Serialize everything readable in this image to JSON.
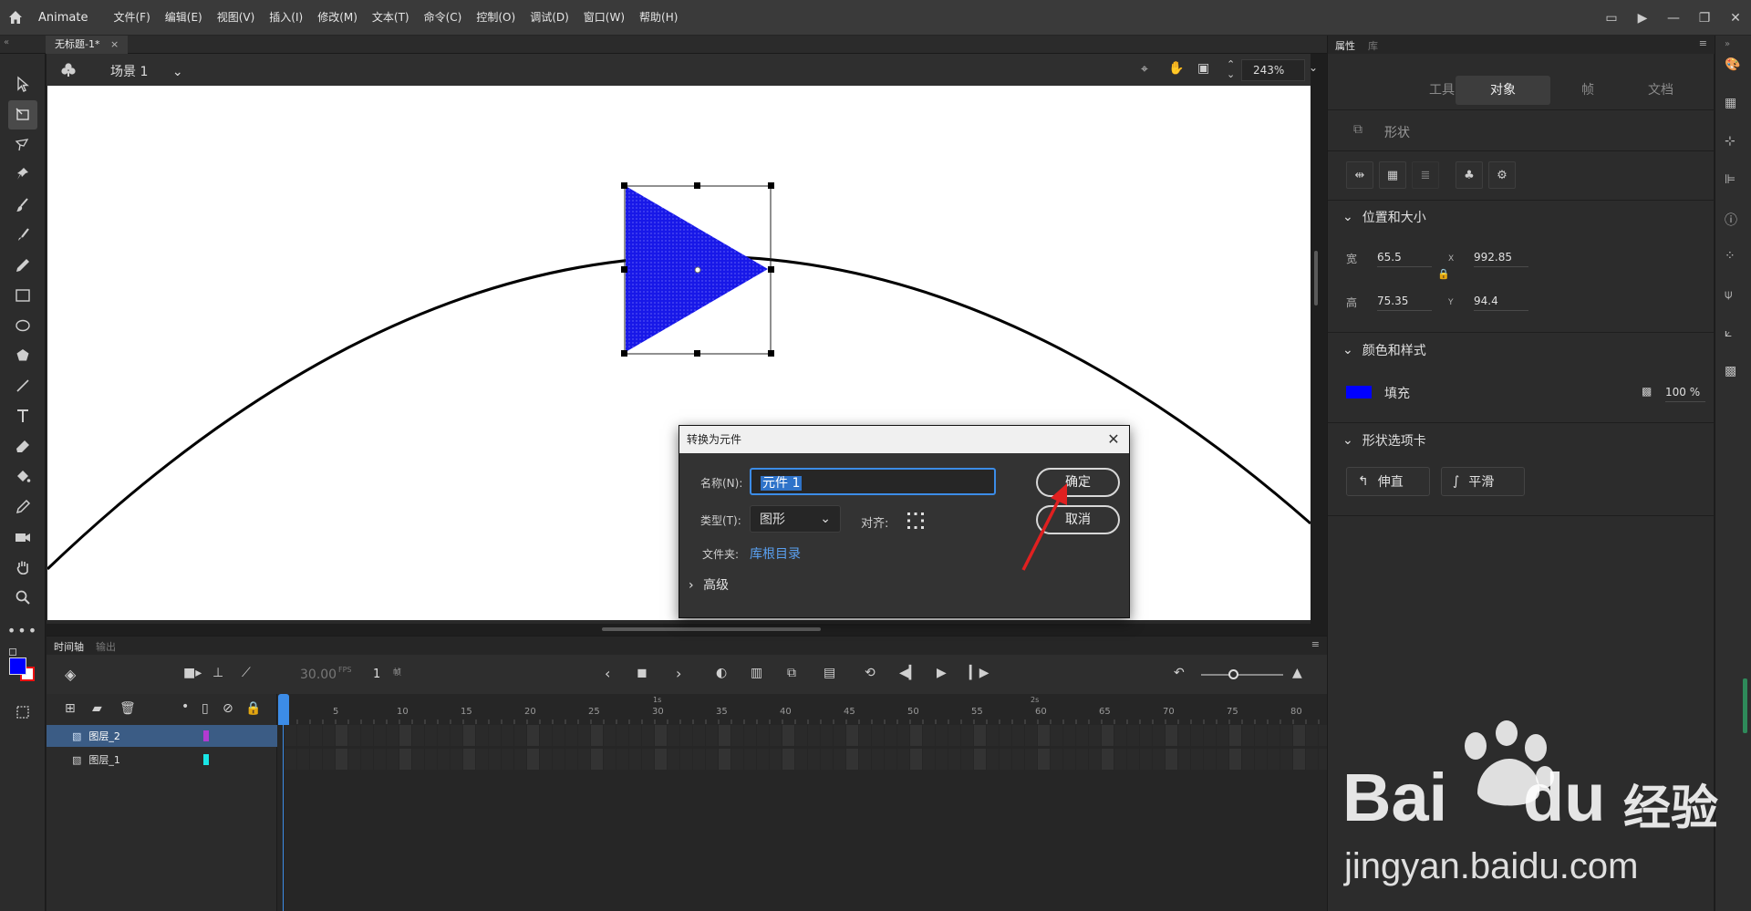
{
  "menubar": {
    "app_name": "Animate",
    "items": [
      "文件(F)",
      "编辑(E)",
      "视图(V)",
      "插入(I)",
      "修改(M)",
      "文本(T)",
      "命令(C)",
      "控制(O)",
      "调试(D)",
      "窗口(W)",
      "帮助(H)"
    ]
  },
  "document": {
    "tab_label": "无标题-1*",
    "scene_label": "场景 1",
    "zoom": "243%"
  },
  "dialog": {
    "title": "转换为元件",
    "name_label": "名称(N):",
    "name_value": "元件 1",
    "type_label": "类型(T):",
    "type_value": "图形",
    "align_label": "对齐:",
    "folder_label": "文件夹:",
    "folder_value": "库根目录",
    "advanced_label": "高级",
    "ok_label": "确定",
    "cancel_label": "取消"
  },
  "timeline": {
    "tab_timeline": "时间轴",
    "tab_output": "输出",
    "fps": "30.00",
    "fps_unit": "FPS",
    "current_frame": "1",
    "frame_unit": "帧",
    "time_markers": [
      "1s",
      "2s"
    ],
    "frame_numbers": [
      "5",
      "10",
      "15",
      "20",
      "25",
      "30",
      "35",
      "40",
      "45",
      "50",
      "55",
      "60",
      "65",
      "70",
      "75",
      "80"
    ],
    "layers": [
      {
        "name": "图层_2",
        "color": "#b23bd1",
        "selected": true
      },
      {
        "name": "图层_1",
        "color": "#19e6e6",
        "selected": false
      }
    ]
  },
  "properties": {
    "tab_properties": "属性",
    "tab_library": "库",
    "tabs": [
      "工具",
      "对象",
      "帧",
      "文档"
    ],
    "active_tab": "对象",
    "object_type": "形状",
    "section_position": "位置和大小",
    "width_label": "宽",
    "width_value": "65.5",
    "height_label": "高",
    "height_value": "75.35",
    "x_label": "X",
    "x_value": "992.85",
    "y_label": "Y",
    "y_value": "94.4",
    "section_color": "颜色和样式",
    "fill_label": "填充",
    "fill_color": "#0000ff",
    "fill_alpha": "100 %",
    "section_shape": "形状选项卡",
    "straighten_label": "伸直",
    "smooth_label": "平滑"
  },
  "colors": {
    "accent": "#3c8ce7",
    "fill_blue": "#0000ff"
  },
  "watermark": {
    "brand": "Bai",
    "brand_suffix": "du",
    "site_cn": "经验",
    "url": "jingyan.baidu.com"
  }
}
